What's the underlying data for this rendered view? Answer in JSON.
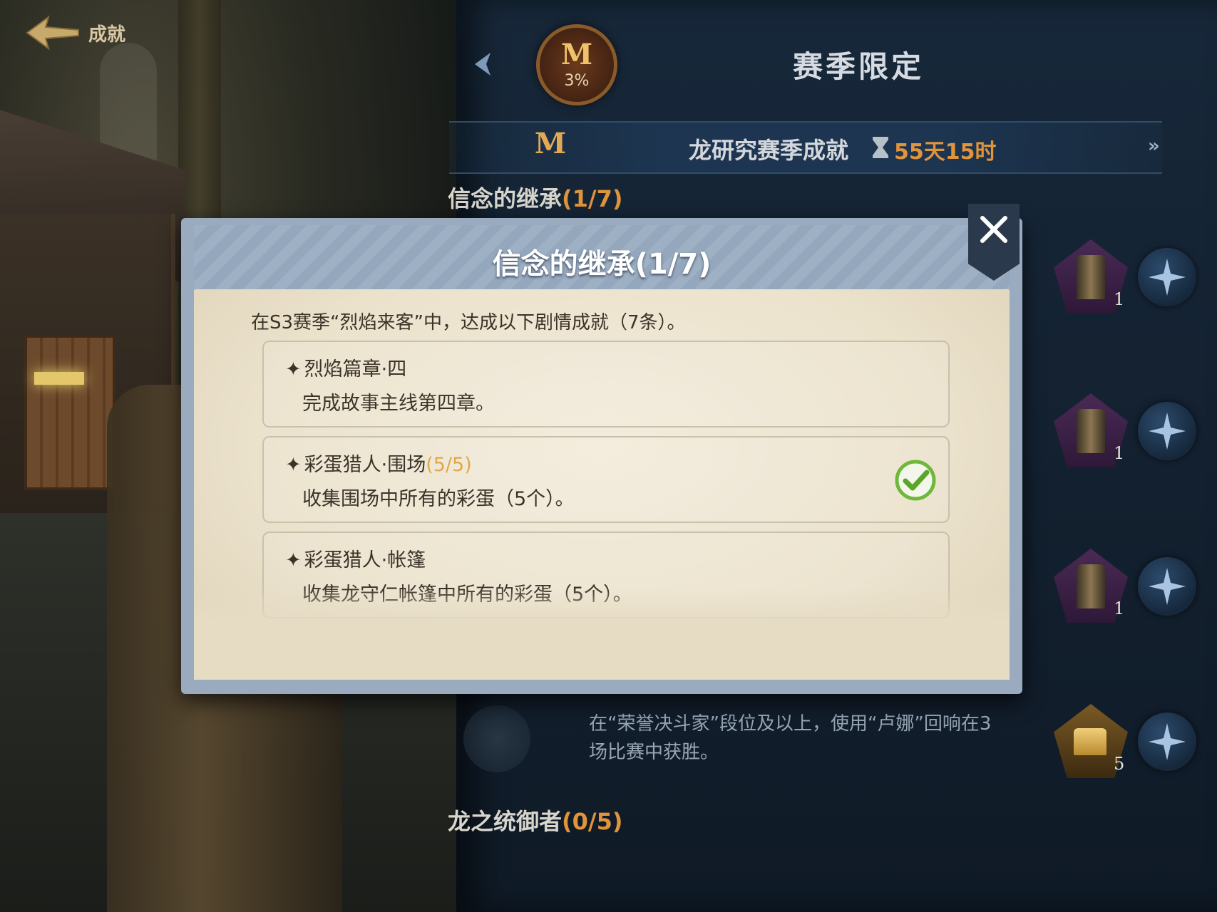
{
  "header": {
    "back_label": "成就",
    "title": "赛季限定",
    "season_percent": "3%",
    "season_glyph": "M"
  },
  "season_bar": {
    "title": "龙研究赛季成就",
    "time_left": "55天15时",
    "more_icon": "double-chevron-right-icon",
    "glyph": "M"
  },
  "groups": [
    {
      "name": "信念的继承",
      "progress": "(1/7)"
    },
    {
      "name": "龙之统御者",
      "progress": "(0/5)"
    }
  ],
  "rewards": [
    {
      "count": "1",
      "icon": "outfit-icon"
    },
    {
      "count": "1",
      "icon": "outfit-icon"
    },
    {
      "count": "1",
      "icon": "outfit-icon"
    },
    {
      "count": "5",
      "icon": "gold-ingot-icon"
    }
  ],
  "background_achievement": {
    "description": "在“荣誉决斗家”段位及以上，使用“卢娜”回响在3场比赛中获胜。"
  },
  "modal": {
    "title": "信念的继承",
    "progress": "(1/7)",
    "intro": "在S3赛季“烈焰来客”中，达成以下剧情成就（7条）。",
    "entries": [
      {
        "name": "烈焰篇章·四",
        "progress": "",
        "desc": "完成故事主线第四章。",
        "done": false
      },
      {
        "name": "彩蛋猎人·围场",
        "progress": "(5/5)",
        "desc": "收集围场中所有的彩蛋（5个）。",
        "done": true
      },
      {
        "name": "彩蛋猎人·帐篷",
        "progress": "",
        "desc": "收集龙守仁帐篷中所有的彩蛋（5个）。",
        "done": false
      }
    ],
    "bullet": "✦"
  },
  "colors": {
    "accent_orange": "#e0943c",
    "panel_blue": "#17283a",
    "paper": "#ebe2cc",
    "check_green": "#6fb83a"
  }
}
